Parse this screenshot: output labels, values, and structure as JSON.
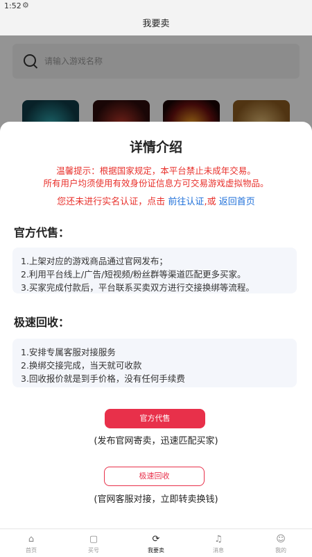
{
  "status_bar": {
    "time": "1:52",
    "settings_icon": "gear-icon"
  },
  "nav": {
    "title": "我要卖"
  },
  "search": {
    "placeholder": "请输入游戏名称",
    "icon": "search-icon"
  },
  "games": [
    {
      "name": "game-thumb-1"
    },
    {
      "name": "game-thumb-2"
    },
    {
      "name": "game-thumb-3"
    },
    {
      "name": "game-thumb-4"
    }
  ],
  "modal": {
    "title": "详情介绍",
    "notice_line1": "温馨提示：根据国家规定，本平台禁止未成年交易。",
    "notice_line2": "所有用户均须使用有效身份证信息方可交易游戏虚拟物品。",
    "verify_prefix": "您还未进行实名认证，点击",
    "verify_link": "前往认证",
    "verify_or": ",或",
    "home_link": "返回首页",
    "official_heading": "官方代售：",
    "official_items": [
      "1.上架对应的游戏商品通过官网发布；",
      "2.利用平台线上/广告/短视频/粉丝群等渠道匹配更多买家。",
      "3.买家完成付款后，平台联系买卖双方进行交接换绑等流程。"
    ],
    "fast_heading": "极速回收：",
    "fast_items": [
      "1.安排专属客服对接服务",
      "2.换绑交接完成，当天就可收款",
      "3.回收报价就是到手价格，没有任何手续费"
    ],
    "official_button": "官方代售",
    "official_caption": "(发布官网寄卖，迅速匹配买家)",
    "fast_button": "极速回收",
    "fast_caption": "(官网客服对接，立即转卖换钱)"
  },
  "tabs": [
    {
      "label": "首页",
      "icon": "home-icon"
    },
    {
      "label": "买号",
      "icon": "bag-icon"
    },
    {
      "label": "我要卖",
      "icon": "sell-icon"
    },
    {
      "label": "消息",
      "icon": "bell-icon"
    },
    {
      "label": "我的",
      "icon": "profile-icon"
    }
  ],
  "colors": {
    "accent_red": "#e8304a",
    "notice_red": "#e8302b",
    "link_blue": "#1e6fd9"
  }
}
